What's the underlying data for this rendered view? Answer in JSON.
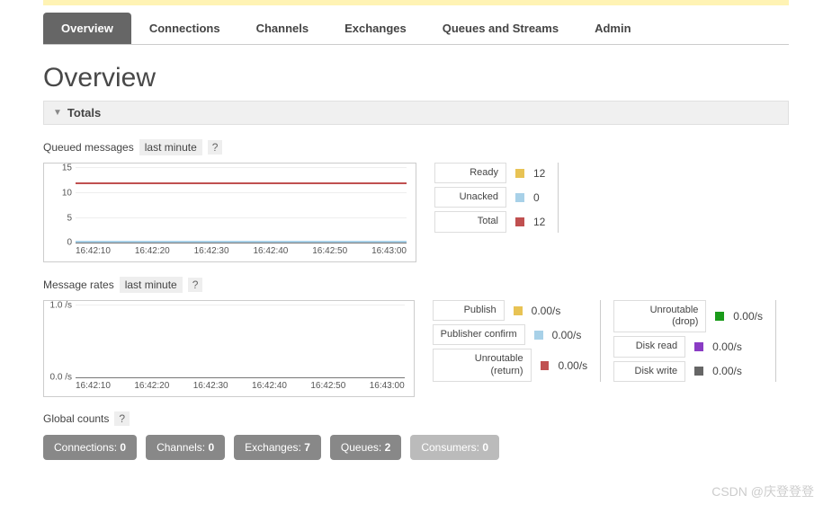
{
  "tabs": [
    "Overview",
    "Connections",
    "Channels",
    "Exchanges",
    "Queues and Streams",
    "Admin"
  ],
  "page_title": "Overview",
  "section_totals": "Totals",
  "queued": {
    "title": "Queued messages",
    "range": "last minute",
    "help": "?",
    "legend": [
      {
        "label": "Ready",
        "value": "12",
        "color": "#e8c354"
      },
      {
        "label": "Unacked",
        "value": "0",
        "color": "#a8d1e8"
      },
      {
        "label": "Total",
        "value": "12",
        "color": "#c05050"
      }
    ]
  },
  "rates": {
    "title": "Message rates",
    "range": "last minute",
    "help": "?",
    "col1": [
      {
        "label": "Publish",
        "value": "0.00/s",
        "color": "#e8c354"
      },
      {
        "label": "Publisher confirm",
        "value": "0.00/s",
        "color": "#a8d1e8"
      },
      {
        "label": "Unroutable (return)",
        "value": "0.00/s",
        "color": "#c05050"
      }
    ],
    "col2": [
      {
        "label": "Unroutable (drop)",
        "value": "0.00/s",
        "color": "#1a9b1a"
      },
      {
        "label": "Disk read",
        "value": "0.00/s",
        "color": "#8a3cc4"
      },
      {
        "label": "Disk write",
        "value": "0.00/s",
        "color": "#666666"
      }
    ]
  },
  "global": {
    "title": "Global counts",
    "help": "?",
    "items": [
      {
        "label": "Connections:",
        "value": "0"
      },
      {
        "label": "Channels:",
        "value": "0"
      },
      {
        "label": "Exchanges:",
        "value": "7"
      },
      {
        "label": "Queues:",
        "value": "2"
      },
      {
        "label": "Consumers:",
        "value": "0"
      }
    ]
  },
  "watermark": "CSDN @庆登登登",
  "chart_data": [
    {
      "type": "line",
      "title": "Queued messages",
      "x": [
        "16:42:10",
        "16:42:20",
        "16:42:30",
        "16:42:40",
        "16:42:50",
        "16:43:00"
      ],
      "series": [
        {
          "name": "Ready",
          "values": [
            12,
            12,
            12,
            12,
            12,
            12
          ],
          "color": "#e8c354"
        },
        {
          "name": "Unacked",
          "values": [
            0,
            0,
            0,
            0,
            0,
            0
          ],
          "color": "#a8d1e8"
        },
        {
          "name": "Total",
          "values": [
            12,
            12,
            12,
            12,
            12,
            12
          ],
          "color": "#c05050"
        }
      ],
      "ylim": [
        0,
        15
      ],
      "yticks": [
        0,
        5,
        10,
        15
      ],
      "xlabel": "",
      "ylabel": ""
    },
    {
      "type": "line",
      "title": "Message rates",
      "x": [
        "16:42:10",
        "16:42:20",
        "16:42:30",
        "16:42:40",
        "16:42:50",
        "16:43:00"
      ],
      "series": [
        {
          "name": "Publish",
          "values": [
            0,
            0,
            0,
            0,
            0,
            0
          ],
          "color": "#e8c354"
        },
        {
          "name": "Publisher confirm",
          "values": [
            0,
            0,
            0,
            0,
            0,
            0
          ],
          "color": "#a8d1e8"
        },
        {
          "name": "Unroutable (return)",
          "values": [
            0,
            0,
            0,
            0,
            0,
            0
          ],
          "color": "#c05050"
        },
        {
          "name": "Unroutable (drop)",
          "values": [
            0,
            0,
            0,
            0,
            0,
            0
          ],
          "color": "#1a9b1a"
        },
        {
          "name": "Disk read",
          "values": [
            0,
            0,
            0,
            0,
            0,
            0
          ],
          "color": "#8a3cc4"
        },
        {
          "name": "Disk write",
          "values": [
            0,
            0,
            0,
            0,
            0,
            0
          ],
          "color": "#666666"
        }
      ],
      "ylim": [
        0,
        1
      ],
      "yticks": [
        0,
        1
      ],
      "yunit": "/s",
      "xlabel": "",
      "ylabel": ""
    }
  ]
}
